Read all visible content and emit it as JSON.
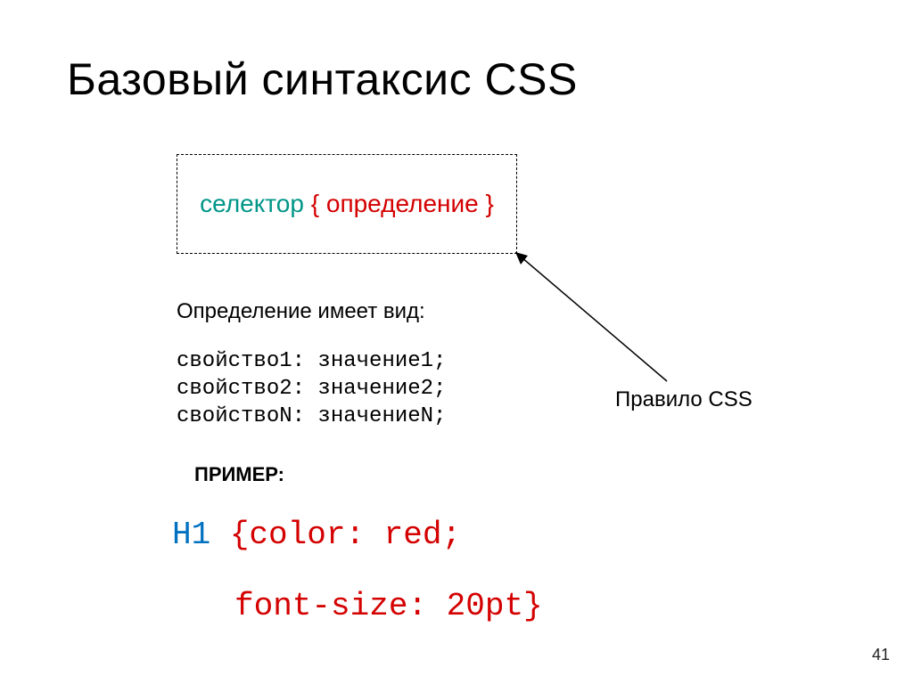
{
  "title": "Базовый синтаксис CSS",
  "syntax": {
    "selector": "селектор",
    "brace_and_def": "{ определение }"
  },
  "subhead": "Определение имеет вид:",
  "properties": [
    "свойство1: значение1;",
    "свойство2: значение2;",
    "свойствоN: значениеN;"
  ],
  "example_label": "ПРИМЕР:",
  "example": {
    "selector": "H1",
    "line1_rest": " {color: red;",
    "line2": "font-size: 20pt}"
  },
  "rule_label": "Правило CSS",
  "page_number": "41"
}
